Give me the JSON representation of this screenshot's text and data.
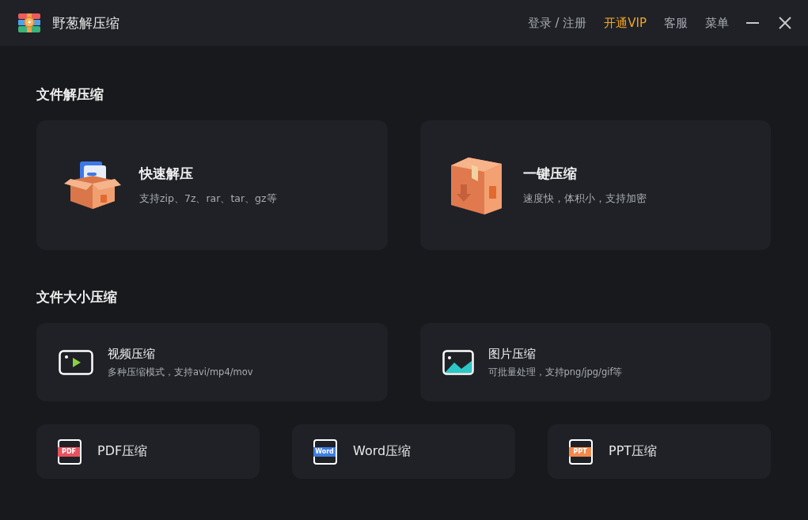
{
  "window": {
    "title": "野葱解压缩"
  },
  "nav": [
    {
      "label": "登录 / 注册",
      "highlighted": false
    },
    {
      "label": "开通VIP",
      "highlighted": true
    },
    {
      "label": "客服",
      "highlighted": false
    },
    {
      "label": "菜单",
      "highlighted": false
    }
  ],
  "sections": [
    {
      "title": "文件解压缩",
      "cards": [
        {
          "kind": "extract",
          "title": "快速解压",
          "subtitle": "支持zip、7z、rar、tar、gz等"
        },
        {
          "kind": "compress",
          "title": "一键压缩",
          "subtitle": "速度快，体积小，支持加密"
        }
      ]
    },
    {
      "title": "文件大小压缩",
      "cards": [
        {
          "kind": "video",
          "title": "视频压缩",
          "subtitle": "多种压缩模式，支持avi/mp4/mov"
        },
        {
          "kind": "image",
          "title": "图片压缩",
          "subtitle": "可批量处理，支持png/jpg/gif等"
        }
      ]
    }
  ],
  "documents": [
    {
      "badge": "PDF",
      "label": "PDF压缩",
      "color": "#e8515e"
    },
    {
      "badge": "Word",
      "label": "Word压缩",
      "color": "#3f7de0"
    },
    {
      "badge": "PPT",
      "label": "PPT压缩",
      "color": "#f5894a"
    }
  ]
}
